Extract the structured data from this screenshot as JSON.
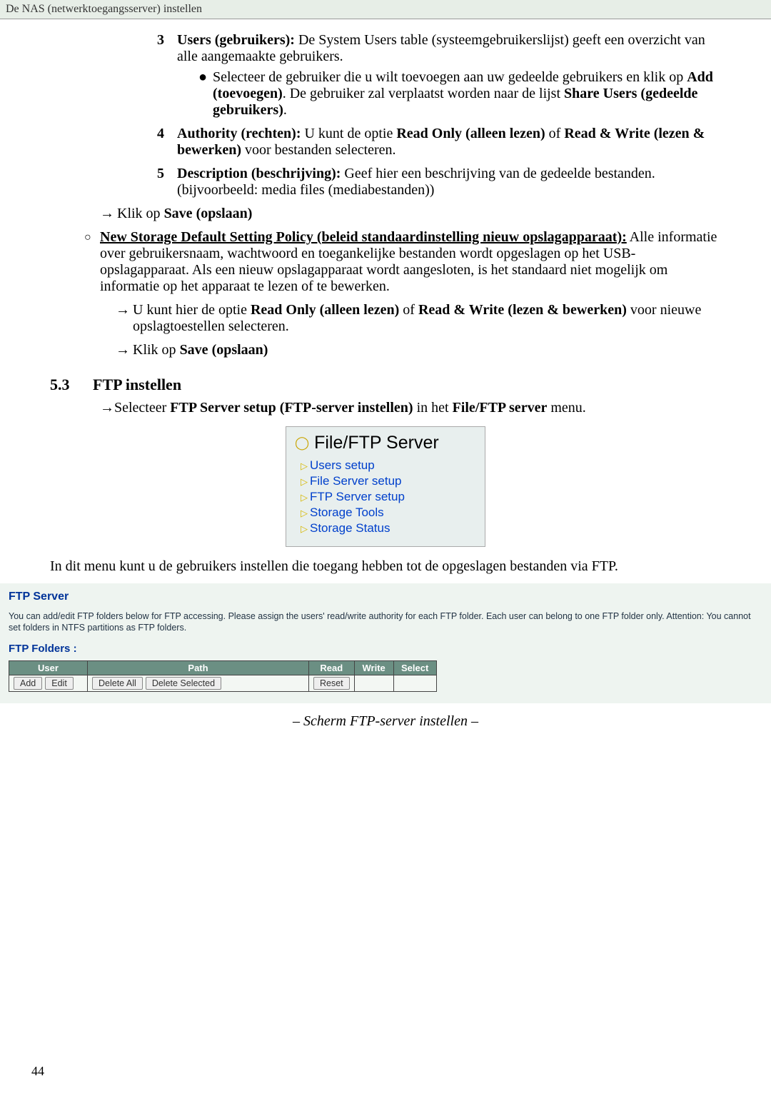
{
  "header": "De NAS (netwerktoegangsserver) instellen",
  "items": {
    "three": {
      "num": "3",
      "title": "Users (gebruikers):",
      "rest": " De System Users table (systeemgebruikerslijst) geeft een overzicht van alle aangemaakte gebruikers.",
      "bullet_a": "Selecteer de gebruiker die u wilt toevoegen aan uw gedeelde gebruikers en klik op ",
      "bullet_b": "Add (toevoegen)",
      "bullet_c": ". De gebruiker zal verplaatst worden naar de lijst ",
      "bullet_d": "Share Users (gedeelde gebruikers)",
      "bullet_e": "."
    },
    "four": {
      "num": "4",
      "title": "Authority (rechten):",
      "rest_a": " U kunt de optie ",
      "rest_b": "Read Only (alleen lezen)",
      "rest_c": " of ",
      "rest_d": "Read & Write (lezen & bewerken)",
      "rest_e": " voor bestanden selecteren."
    },
    "five": {
      "num": "5",
      "title": "Description (beschrijving):",
      "rest": " Geef hier een beschrijving van de gedeelde bestanden. (bijvoorbeeld: media files (mediabestanden))"
    }
  },
  "klik_a": "Klik op ",
  "klik_b": "Save (opslaan)",
  "circle_section": {
    "title": "New Storage Default Setting Policy (beleid standaardinstelling nieuw opslagapparaat):",
    "rest": " Alle informatie over gebruikersnaam, wachtwoord en toegankelijke bestanden wordt opgeslagen op het USB-opslagapparaat. Als een nieuw opslagapparaat wordt aangesloten, is het standaard niet mogelijk om informatie op het apparaat te lezen of te bewerken.",
    "sub1_a": "U kunt hier de optie ",
    "sub1_b": "Read Only (alleen lezen)",
    "sub1_c": " of ",
    "sub1_d": "Read & Write (lezen & bewerken)",
    "sub1_e": " voor nieuwe opslagtoestellen selecteren."
  },
  "section53": {
    "num": "5.3",
    "title": "FTP instellen",
    "line_a": "Selecteer ",
    "line_b": "FTP Server setup (FTP-server instellen)",
    "line_c": " in het ",
    "line_d": "File/FTP server",
    "line_e": " menu."
  },
  "menu": {
    "title": "File/FTP Server",
    "items": [
      "Users setup",
      "File Server setup",
      "FTP Server setup",
      "Storage Tools",
      "Storage Status"
    ]
  },
  "mid_para": "In dit menu kunt u de gebruikers instellen die toegang hebben tot de opgeslagen bestanden via FTP.",
  "ftp_panel": {
    "title": "FTP Server",
    "desc": "You can add/edit FTP folders below for FTP accessing. Please assign the users' read/write authority for each FTP folder. Each user can belong to one FTP folder only. Attention: You cannot set folders in NTFS partitions as FTP folders.",
    "folders_label": "FTP Folders  :",
    "headers": {
      "user": "User",
      "path": "Path",
      "read": "Read",
      "write": "Write",
      "select": "Select"
    },
    "buttons": {
      "add": "Add",
      "edit": "Edit",
      "delete_all": "Delete All",
      "delete_selected": "Delete Selected",
      "reset": "Reset"
    }
  },
  "caption": "– Scherm FTP-server instellen –",
  "page_number": "44",
  "chart_data": {
    "type": "table",
    "columns": [
      "User",
      "Path",
      "Read",
      "Write",
      "Select"
    ],
    "rows": []
  }
}
